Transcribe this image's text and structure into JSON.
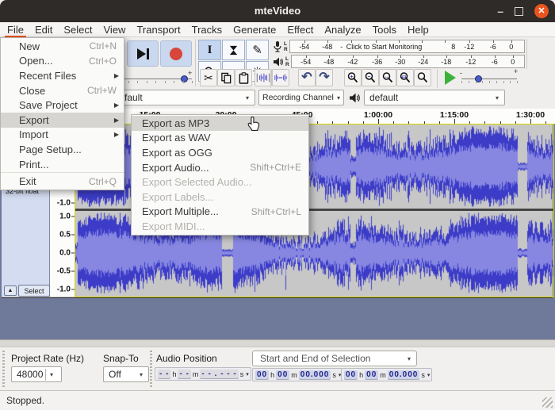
{
  "window": {
    "title": "mteVideo"
  },
  "menubar": {
    "items": [
      "File",
      "Edit",
      "Select",
      "View",
      "Transport",
      "Tracks",
      "Generate",
      "Effect",
      "Analyze",
      "Tools",
      "Help"
    ],
    "active_item": "File"
  },
  "file_menu": {
    "items": [
      {
        "label": "New",
        "shortcut": "Ctrl+N"
      },
      {
        "label": "Open...",
        "shortcut": "Ctrl+O"
      },
      {
        "label": "Recent Files",
        "submenu": true
      },
      {
        "label": "Close",
        "shortcut": "Ctrl+W"
      },
      {
        "label": "Save Project",
        "submenu": true
      },
      {
        "label": "Export",
        "submenu": true,
        "highlighted": true
      },
      {
        "label": "Import",
        "submenu": true
      },
      {
        "label": "Page Setup..."
      },
      {
        "label": "Print...",
        "separator_after": true
      },
      {
        "label": "Exit",
        "shortcut": "Ctrl+Q"
      }
    ]
  },
  "export_menu": {
    "items": [
      {
        "label": "Export as MP3",
        "highlighted": true
      },
      {
        "label": "Export as WAV"
      },
      {
        "label": "Export as OGG"
      },
      {
        "label": "Export Audio...",
        "shortcut": "Shift+Ctrl+E"
      },
      {
        "label": "Export Selected Audio...",
        "disabled": true
      },
      {
        "label": "Export Labels...",
        "disabled": true
      },
      {
        "label": "Export Multiple...",
        "shortcut": "Shift+Ctrl+L"
      },
      {
        "label": "Export MIDI...",
        "disabled": true
      }
    ]
  },
  "meters": {
    "recording": {
      "channel_labels": [
        "L",
        "R"
      ],
      "scale_left": [
        "-54",
        "-48",
        "-"
      ],
      "overlay": "Click to Start Monitoring",
      "scale_right": [
        "8",
        "-12",
        "-6",
        "0"
      ]
    },
    "playback": {
      "channel_labels": [
        "L",
        "R"
      ],
      "scale": [
        "-54",
        "-48",
        "-42",
        "-36",
        "-30",
        "-24",
        "-18",
        "-12",
        "-6",
        "0"
      ]
    }
  },
  "device_toolbar": {
    "host": "fault",
    "recording_channels": "Recording Channels",
    "playback_device": "default"
  },
  "timeline": {
    "labels": [
      "15:00",
      "30:00",
      "45:00",
      "1:00:00",
      "1:15:00",
      "1:30:00"
    ]
  },
  "track": {
    "format": "32-bit float",
    "select_label": "Select",
    "collapse_icon": "▲",
    "vertical_scale": [
      "1.0",
      "0.5",
      "0.0",
      "-0.5",
      "-1.0"
    ]
  },
  "selection_toolbar": {
    "project_rate_label": "Project Rate (Hz)",
    "project_rate_value": "48000",
    "snap_label": "Snap-To",
    "snap_value": "Off",
    "audio_position_label": "Audio Position",
    "audio_position": {
      "groups": [
        "- -",
        "- -",
        "- - . - - -"
      ],
      "units": [
        "h",
        "m",
        "s"
      ]
    },
    "selection_mode": "Start and End of Selection",
    "selection_start": {
      "groups": [
        "00",
        "00",
        "00.000"
      ],
      "units": [
        "h",
        "m",
        "s"
      ]
    },
    "selection_end": {
      "groups": [
        "00",
        "00",
        "00.000"
      ],
      "units": [
        "h",
        "m",
        "s"
      ]
    }
  },
  "status_bar": {
    "text": "Stopped."
  },
  "icons": {
    "selection_tool": "I",
    "draw_tool": "✎",
    "timeshift_tool": "↔",
    "multi_tool": "✳",
    "cut": "✂",
    "undo": "↶",
    "redo": "↷",
    "combo_arrow": "▾",
    "submenu_arrow": "▶",
    "minus": "-",
    "plus": "+"
  },
  "colors": {
    "titlebar": "#2e2b29",
    "accent_orange": "#e9541f",
    "record_red": "#d8453a",
    "waveform": "#3c3cc8",
    "waveform_rms": "#8787e2",
    "track_panel": "#d3dcf0",
    "selected_track_border": "#d6d600",
    "workspace": "#6f7999",
    "play_green": "#3cb23c"
  }
}
